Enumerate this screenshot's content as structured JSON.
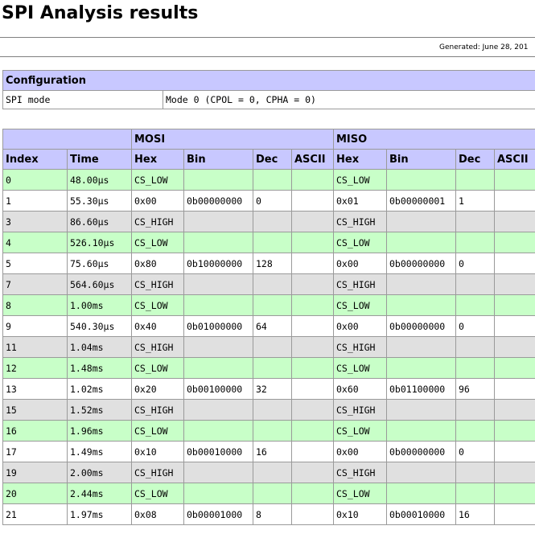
{
  "page": {
    "title": "SPI Analysis results",
    "generated": "Generated: June 28, 201"
  },
  "config": {
    "heading": "Configuration",
    "rows": [
      {
        "label": "SPI mode",
        "value": "Mode 0 (CPOL = 0, CPHA = 0)"
      }
    ]
  },
  "table": {
    "groups": {
      "mosi": "MOSI",
      "miso": "MISO"
    },
    "columns": [
      "Index",
      "Time",
      "Hex",
      "Bin",
      "Dec",
      "ASCII",
      "Hex",
      "Bin",
      "Dec",
      "ASCII"
    ],
    "rows": [
      {
        "style": "green",
        "cells": [
          "0",
          "48.00µs",
          "CS_LOW",
          "",
          "",
          "",
          "CS_LOW",
          "",
          "",
          ""
        ]
      },
      {
        "style": "white",
        "cells": [
          "1",
          "55.30µs",
          "0x00",
          "0b00000000",
          "0",
          "",
          "0x01",
          "0b00000001",
          "1",
          ""
        ]
      },
      {
        "style": "gray",
        "cells": [
          "3",
          "86.60µs",
          "CS_HIGH",
          "",
          "",
          "",
          "CS_HIGH",
          "",
          "",
          ""
        ]
      },
      {
        "style": "green",
        "cells": [
          "4",
          "526.10µs",
          "CS_LOW",
          "",
          "",
          "",
          "CS_LOW",
          "",
          "",
          ""
        ]
      },
      {
        "style": "white",
        "cells": [
          "5",
          "75.60µs",
          "0x80",
          "0b10000000",
          "128",
          "",
          "0x00",
          "0b00000000",
          "0",
          ""
        ]
      },
      {
        "style": "gray",
        "cells": [
          "7",
          "564.60µs",
          "CS_HIGH",
          "",
          "",
          "",
          "CS_HIGH",
          "",
          "",
          ""
        ]
      },
      {
        "style": "green",
        "cells": [
          "8",
          "1.00ms",
          "CS_LOW",
          "",
          "",
          "",
          "CS_LOW",
          "",
          "",
          ""
        ]
      },
      {
        "style": "white",
        "cells": [
          "9",
          "540.30µs",
          "0x40",
          "0b01000000",
          "64",
          "",
          "0x00",
          "0b00000000",
          "0",
          ""
        ]
      },
      {
        "style": "gray",
        "cells": [
          "11",
          "1.04ms",
          "CS_HIGH",
          "",
          "",
          "",
          "CS_HIGH",
          "",
          "",
          ""
        ]
      },
      {
        "style": "green",
        "cells": [
          "12",
          "1.48ms",
          "CS_LOW",
          "",
          "",
          "",
          "CS_LOW",
          "",
          "",
          ""
        ]
      },
      {
        "style": "white",
        "cells": [
          "13",
          "1.02ms",
          "0x20",
          "0b00100000",
          "32",
          "",
          "0x60",
          "0b01100000",
          "96",
          ""
        ]
      },
      {
        "style": "gray",
        "cells": [
          "15",
          "1.52ms",
          "CS_HIGH",
          "",
          "",
          "",
          "CS_HIGH",
          "",
          "",
          ""
        ]
      },
      {
        "style": "green",
        "cells": [
          "16",
          "1.96ms",
          "CS_LOW",
          "",
          "",
          "",
          "CS_LOW",
          "",
          "",
          ""
        ]
      },
      {
        "style": "white",
        "cells": [
          "17",
          "1.49ms",
          "0x10",
          "0b00010000",
          "16",
          "",
          "0x00",
          "0b00000000",
          "0",
          ""
        ]
      },
      {
        "style": "gray",
        "cells": [
          "19",
          "2.00ms",
          "CS_HIGH",
          "",
          "",
          "",
          "CS_HIGH",
          "",
          "",
          ""
        ]
      },
      {
        "style": "green",
        "cells": [
          "20",
          "2.44ms",
          "CS_LOW",
          "",
          "",
          "",
          "CS_LOW",
          "",
          "",
          ""
        ]
      },
      {
        "style": "white",
        "cells": [
          "21",
          "1.97ms",
          "0x08",
          "0b00001000",
          "8",
          "",
          "0x10",
          "0b00010000",
          "16",
          ""
        ]
      }
    ]
  },
  "colors": {
    "header_bg": "#c8c8ff",
    "row_green": "#c8ffc8",
    "row_gray": "#e0e0e0",
    "row_white": "#ffffff"
  }
}
